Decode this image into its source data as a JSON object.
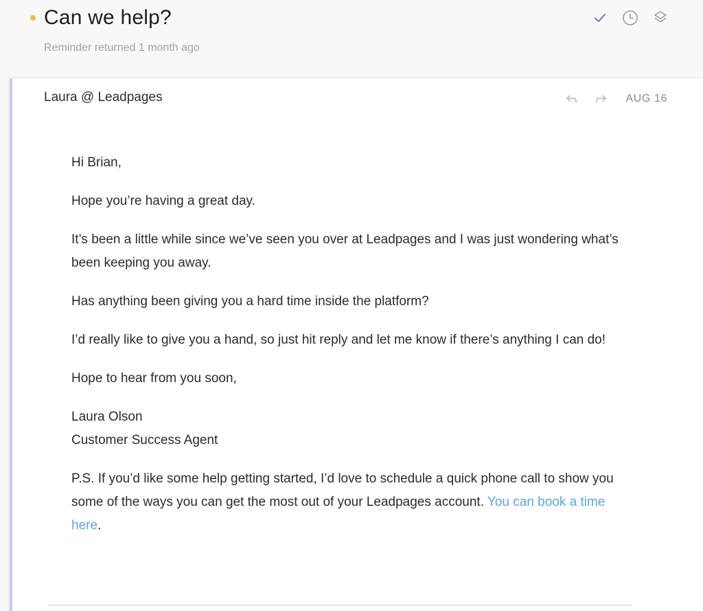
{
  "thread": {
    "subject": "Can we help?",
    "reminder": "Reminder returned 1 month ago",
    "unread_color": "#f5b942",
    "actions": [
      {
        "name": "done",
        "icon": "check-icon"
      },
      {
        "name": "remind",
        "icon": "clock-icon"
      },
      {
        "name": "move",
        "icon": "layers-icon"
      }
    ]
  },
  "message": {
    "sender": "Laura @ Leadpages",
    "date": "AUG 16",
    "greeting": "Hi Brian,",
    "p1": "Hope you’re having a great day.",
    "p2": "It’s been a little while since we’ve seen you over at Leadpages and I was just wondering what’s been keeping you away.",
    "p3": "Has anything been giving you a hard time inside the platform?",
    "p4": "I’d really like to give you a hand, so just hit reply and let me know if there’s anything I can do!",
    "closing": "Hope to hear from you soon,",
    "signature_name": "Laura Olson",
    "signature_title": "Customer Success Agent",
    "ps_text": "P.S. If you’d like some help getting started, I’d love to schedule a quick phone call to show you some of the ways you can get the most out of your Leadpages account. ",
    "ps_link": "You can book a time here",
    "ps_end": ".",
    "accent_color": "#c9cdea",
    "link_color": "#5aa7d8"
  }
}
